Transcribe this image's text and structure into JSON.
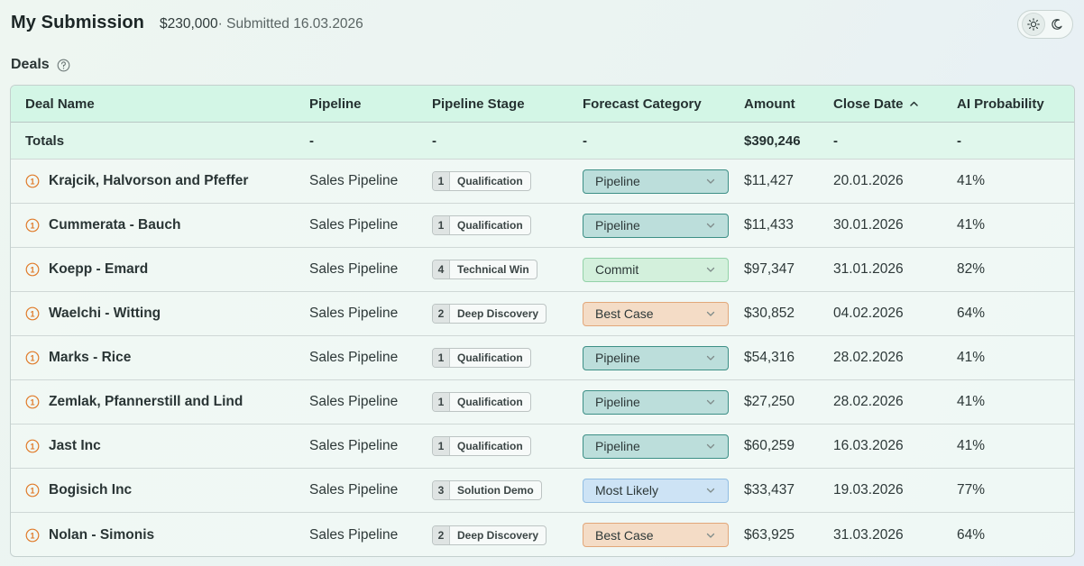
{
  "header": {
    "title": "My Submission",
    "amount": "$230,000",
    "submitted": "· Submitted 16.03.2026"
  },
  "theme": {
    "icons": [
      "sun-icon",
      "moon-icon"
    ],
    "active": "light"
  },
  "deals": {
    "label": "Deals",
    "help_icon": "question-circle-icon"
  },
  "table": {
    "columns": [
      "Deal Name",
      "Pipeline",
      "Pipeline Stage",
      "Forecast Category",
      "Amount",
      "Close Date",
      "AI Probability"
    ],
    "sort": {
      "column": "Close Date",
      "direction": "asc"
    },
    "totals": {
      "label": "Totals",
      "pipeline": "-",
      "stage": "-",
      "forecast": "-",
      "amount": "$390,246",
      "close": "-",
      "ai": "-"
    },
    "rows": [
      {
        "name": "Krajcik, Halvorson and Pfeffer",
        "pipeline": "Sales Pipeline",
        "stage_num": "1",
        "stage": "Qualification",
        "forecast": "Pipeline",
        "amount": "$11,427",
        "close": "20.01.2026",
        "ai": "41%"
      },
      {
        "name": "Cummerata - Bauch",
        "pipeline": "Sales Pipeline",
        "stage_num": "1",
        "stage": "Qualification",
        "forecast": "Pipeline",
        "amount": "$11,433",
        "close": "30.01.2026",
        "ai": "41%"
      },
      {
        "name": "Koepp - Emard",
        "pipeline": "Sales Pipeline",
        "stage_num": "4",
        "stage": "Technical Win",
        "forecast": "Commit",
        "amount": "$97,347",
        "close": "31.01.2026",
        "ai": "82%"
      },
      {
        "name": "Waelchi - Witting",
        "pipeline": "Sales Pipeline",
        "stage_num": "2",
        "stage": "Deep Discovery",
        "forecast": "Best Case",
        "amount": "$30,852",
        "close": "04.02.2026",
        "ai": "64%"
      },
      {
        "name": "Marks - Rice",
        "pipeline": "Sales Pipeline",
        "stage_num": "1",
        "stage": "Qualification",
        "forecast": "Pipeline",
        "amount": "$54,316",
        "close": "28.02.2026",
        "ai": "41%"
      },
      {
        "name": "Zemlak, Pfannerstill and Lind",
        "pipeline": "Sales Pipeline",
        "stage_num": "1",
        "stage": "Qualification",
        "forecast": "Pipeline",
        "amount": "$27,250",
        "close": "28.02.2026",
        "ai": "41%"
      },
      {
        "name": "Jast Inc",
        "pipeline": "Sales Pipeline",
        "stage_num": "1",
        "stage": "Qualification",
        "forecast": "Pipeline",
        "amount": "$60,259",
        "close": "16.03.2026",
        "ai": "41%"
      },
      {
        "name": "Bogisich Inc",
        "pipeline": "Sales Pipeline",
        "stage_num": "3",
        "stage": "Solution Demo",
        "forecast": "Most Likely",
        "amount": "$33,437",
        "close": "19.03.2026",
        "ai": "77%"
      },
      {
        "name": "Nolan - Simonis",
        "pipeline": "Sales Pipeline",
        "stage_num": "2",
        "stage": "Deep Discovery",
        "forecast": "Best Case",
        "amount": "$63,925",
        "close": "31.03.2026",
        "ai": "64%"
      }
    ]
  },
  "colors": {
    "warning": "#e07b2a",
    "pipeline_bg": "#bcdedb",
    "commit_bg": "#d3f0dc",
    "best_case_bg": "#f4dcc6",
    "most_likely_bg": "#cde3f5",
    "header_bg": "#d3f6e6"
  }
}
